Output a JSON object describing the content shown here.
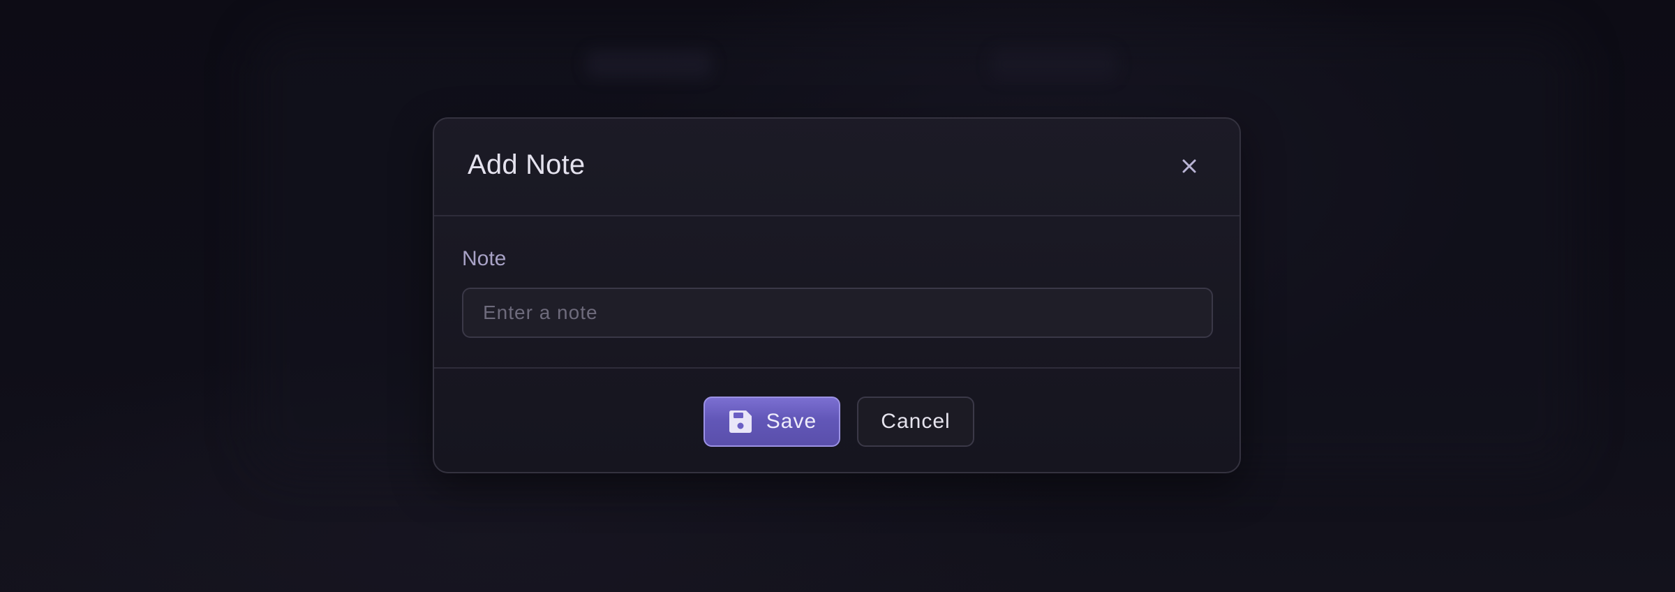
{
  "modal": {
    "title": "Add Note",
    "close_icon": "close-icon"
  },
  "form": {
    "note_label": "Note",
    "note_value": "",
    "note_placeholder": "Enter a note"
  },
  "footer": {
    "save_label": "Save",
    "save_icon": "floppy-disk-icon",
    "cancel_label": "Cancel"
  },
  "colors": {
    "accent": "#6a5fc4",
    "background": "#0e0d16",
    "modal_background": "#1a1924"
  }
}
